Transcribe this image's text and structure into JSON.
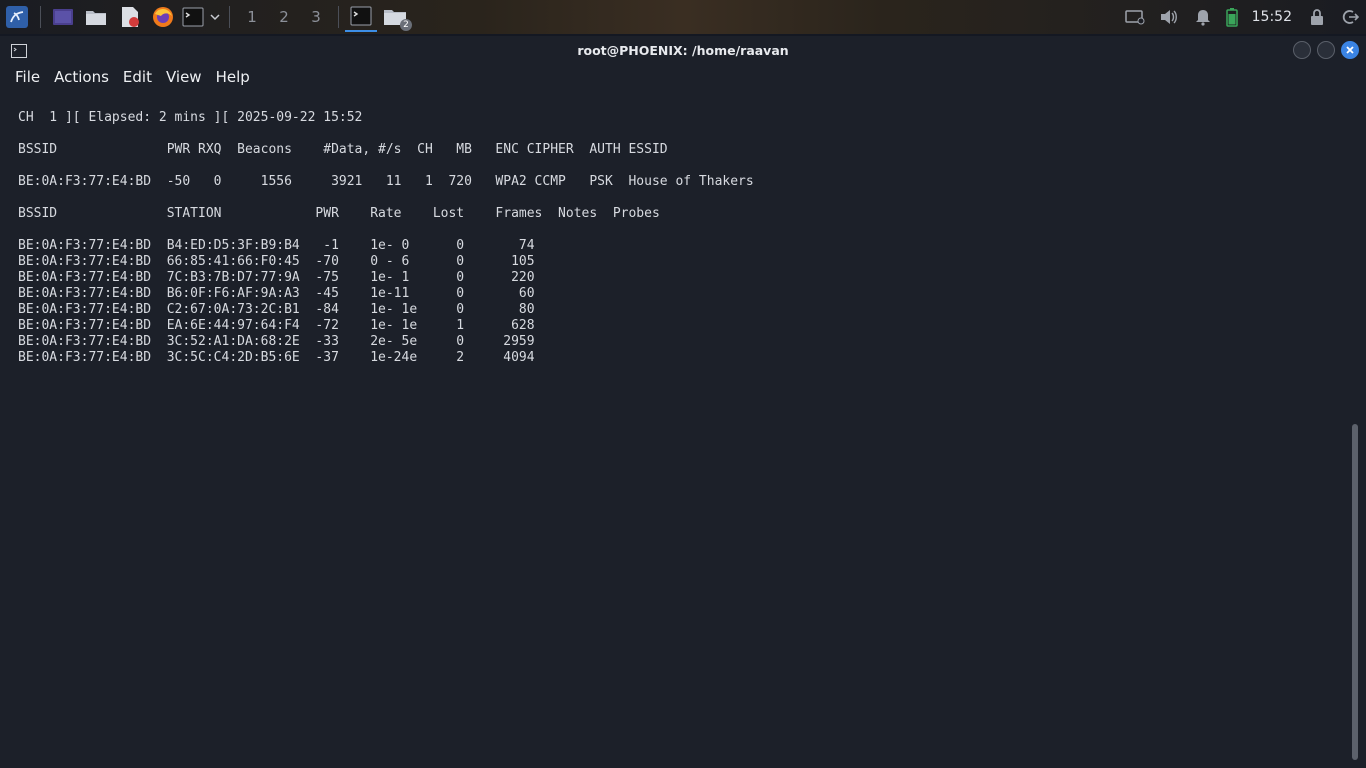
{
  "panel": {
    "workspaces": [
      "1",
      "2",
      "3"
    ],
    "taskbar_badge": "2",
    "clock": "15:52",
    "icons": [
      "kali-menu-icon",
      "desktop-icon",
      "file-manager-icon",
      "text-editor-icon",
      "firefox-icon",
      "terminal-launcher-icon",
      "dropdown-icon",
      "terminal-task-icon",
      "folder-task-icon",
      "monitor-icon",
      "volume-icon",
      "notifications-icon",
      "battery-icon",
      "lock-icon",
      "logout-icon"
    ]
  },
  "window": {
    "title": "root@PHOENIX: /home/raavan",
    "menu": [
      "File",
      "Actions",
      "Edit",
      "View",
      "Help"
    ]
  },
  "terminal": {
    "status": "CH  1 ][ Elapsed: 2 mins ][ 2025-09-22 15:52",
    "ap_header": "BSSID              PWR RXQ  Beacons    #Data, #/s  CH   MB   ENC CIPHER  AUTH ESSID",
    "ap_row": "BE:0A:F3:77:E4:BD  -50   0     1556     3921   11   1  720   WPA2 CCMP   PSK  House of Thakers",
    "sta_header": "BSSID              STATION            PWR    Rate    Lost    Frames  Notes  Probes",
    "sta_rows": [
      "BE:0A:F3:77:E4:BD  B4:ED:D5:3F:B9:B4   -1    1e- 0      0       74",
      "BE:0A:F3:77:E4:BD  66:85:41:66:F0:45  -70    0 - 6      0      105",
      "BE:0A:F3:77:E4:BD  7C:B3:7B:D7:77:9A  -75    1e- 1      0      220",
      "BE:0A:F3:77:E4:BD  B6:0F:F6:AF:9A:A3  -45    1e-11      0       60",
      "BE:0A:F3:77:E4:BD  C2:67:0A:73:2C:B1  -84    1e- 1e     0       80",
      "BE:0A:F3:77:E4:BD  EA:6E:44:97:64:F4  -72    1e- 1e     1      628",
      "BE:0A:F3:77:E4:BD  3C:52:A1:DA:68:2E  -33    2e- 5e     0     2959",
      "BE:0A:F3:77:E4:BD  3C:5C:C4:2D:B5:6E  -37    1e-24e     2     4094"
    ]
  },
  "colors": {
    "accent": "#3b84e4",
    "terminal_bg": "#1c2029",
    "terminal_fg": "#d7dae0"
  }
}
